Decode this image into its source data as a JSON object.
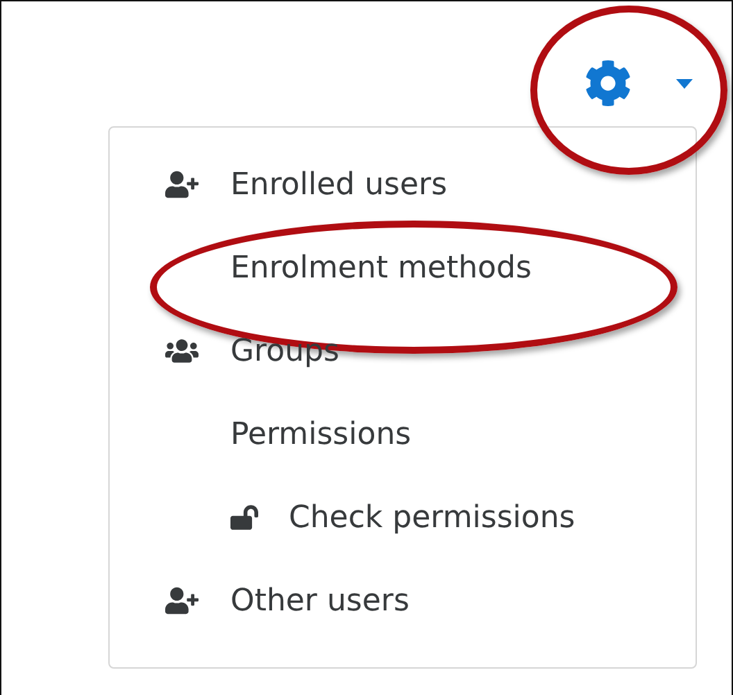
{
  "settings_button": {
    "highlighted": true
  },
  "menu": {
    "items": [
      {
        "label": "Enrolled users",
        "kind": "user-plus",
        "highlighted": false
      },
      {
        "label": "Enrolment methods",
        "kind": "plain",
        "highlighted": true
      },
      {
        "label": "Groups",
        "kind": "users",
        "highlighted": false
      },
      {
        "label": "Permissions",
        "kind": "plain",
        "highlighted": false,
        "children": [
          {
            "label": "Check permissions",
            "kind": "lock",
            "highlighted": false
          }
        ]
      },
      {
        "label": "Other users",
        "kind": "user-plus",
        "highlighted": false
      }
    ]
  }
}
